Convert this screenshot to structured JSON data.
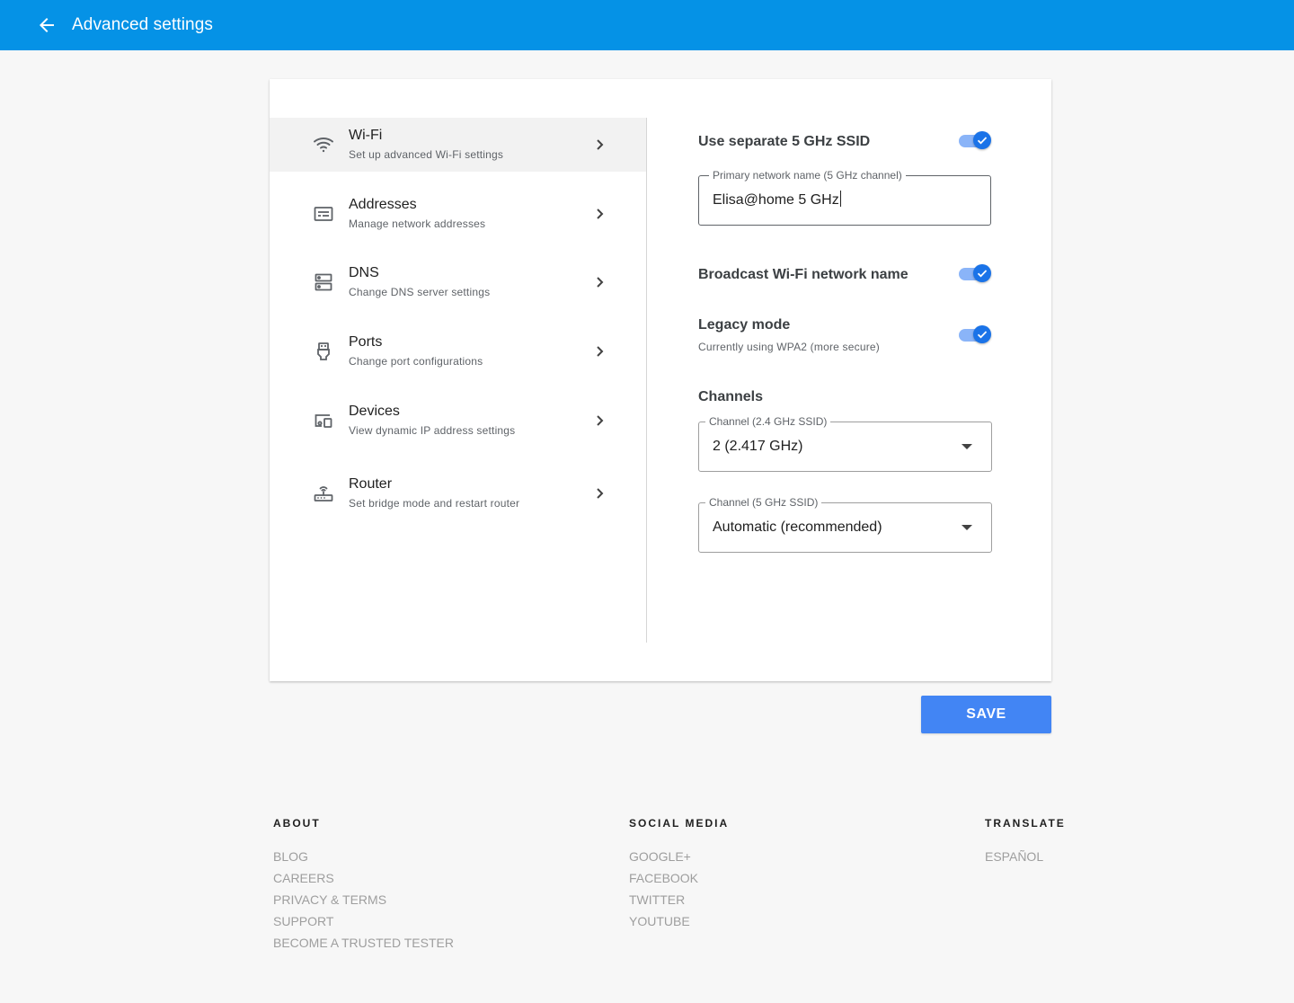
{
  "header": {
    "title": "Advanced settings",
    "background": "#0592e6"
  },
  "nav": {
    "items": [
      {
        "label": "Wi-Fi",
        "sub": "Set up advanced Wi-Fi settings",
        "icon": "wifi-icon",
        "active": true
      },
      {
        "label": "Addresses",
        "sub": "Manage network addresses",
        "icon": "address-card-icon"
      },
      {
        "label": "DNS",
        "sub": "Change DNS server settings",
        "icon": "server-icon"
      },
      {
        "label": "Ports",
        "sub": "Change port configurations",
        "icon": "ethernet-port-icon"
      },
      {
        "label": "Devices",
        "sub": "View dynamic IP address settings",
        "icon": "devices-icon"
      },
      {
        "label": "Router",
        "sub": "Set bridge mode and restart router",
        "icon": "router-icon"
      }
    ]
  },
  "wifi": {
    "separate_ssid": {
      "label": "Use separate 5 GHz SSID",
      "enabled": true
    },
    "primary_name": {
      "label": "Primary network name (5 GHz channel)",
      "value": "Elisa@home 5 GHz"
    },
    "broadcast": {
      "label": "Broadcast Wi-Fi network name",
      "enabled": true
    },
    "legacy": {
      "label": "Legacy mode",
      "sub": "Currently using WPA2 (more secure)",
      "enabled": true
    },
    "channels": {
      "heading": "Channels",
      "ch24": {
        "label": "Channel (2.4 GHz SSID)",
        "value": "2 (2.417 GHz)"
      },
      "ch5": {
        "label": "Channel (5 GHz SSID)",
        "value": "Automatic (recommended)"
      }
    }
  },
  "save_label": "SAVE",
  "accent": "#4285f4",
  "footer": {
    "about": {
      "heading": "ABOUT",
      "links": [
        "BLOG",
        "CAREERS",
        "PRIVACY & TERMS",
        "SUPPORT",
        "BECOME A TRUSTED TESTER"
      ]
    },
    "social": {
      "heading": "SOCIAL MEDIA",
      "links": [
        "GOOGLE+",
        "FACEBOOK",
        "TWITTER",
        "YOUTUBE"
      ]
    },
    "translate": {
      "heading": "TRANSLATE",
      "links": [
        "ESPAÑOL"
      ]
    }
  }
}
